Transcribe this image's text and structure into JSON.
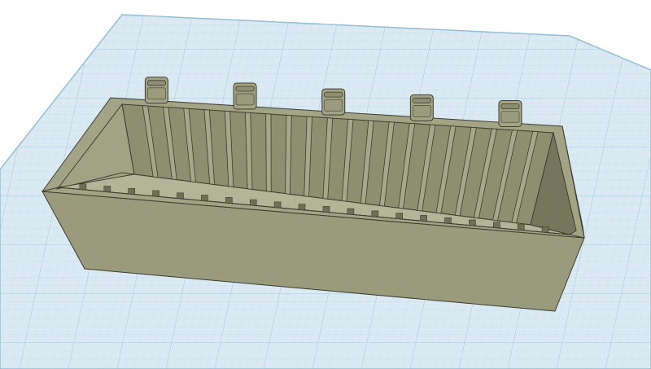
{
  "viewport": {
    "background": "#ffffff",
    "workplane": {
      "fill": "#dbeaf2",
      "minor_grid": "#c4dbe7",
      "major_grid": "#a6c9dc",
      "edge": "#92bdd3"
    }
  },
  "model": {
    "shape": "storage-tray",
    "body_color": "#9a9a7c",
    "top_face_color": "#a3a385",
    "inner_wall_color": "#8e8e71",
    "inner_end_color": "#76765c",
    "floor_color": "#b4b498",
    "edge_color": "#3c3c30",
    "slot_count": 20,
    "clip_count": 5
  }
}
